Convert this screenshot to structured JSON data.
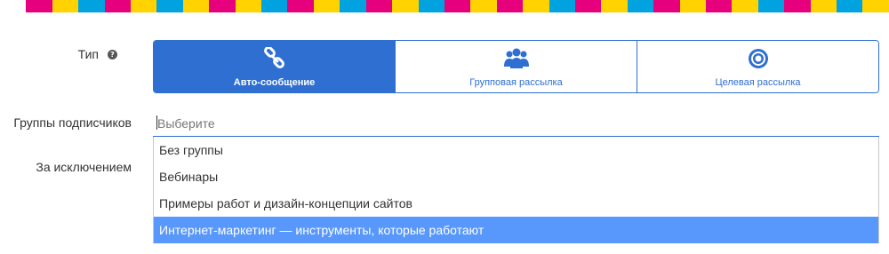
{
  "stripe_colors": [
    "#ffffff",
    "#e6007e",
    "#ffd200",
    "#00a3e0",
    "#e6007e",
    "#ffd200",
    "#00a3e0",
    "#ffd200",
    "#e6007e",
    "#ffd200",
    "#00a3e0",
    "#e6007e",
    "#ffd200",
    "#00a3e0",
    "#e6007e",
    "#ffd200",
    "#00a3e0",
    "#e6007e",
    "#ffd200",
    "#e6007e",
    "#ffd200",
    "#00a3e0",
    "#e6007e",
    "#ffd200",
    "#00a3e0",
    "#e6007e",
    "#ffd200",
    "#e6007e",
    "#ffd200",
    "#00a3e0",
    "#e6007e",
    "#ffd200",
    "#00a3e0",
    "#ffd200"
  ],
  "form": {
    "type_label": "Тип",
    "help_glyph": "?",
    "groups_label": "Группы подписчиков",
    "except_label": "За исключением"
  },
  "type_options": [
    {
      "label": "Авто-сообщение",
      "icon": "link-icon",
      "active": true
    },
    {
      "label": "Групповая рассылка",
      "icon": "users-icon",
      "active": false
    },
    {
      "label": "Целевая рассылка",
      "icon": "target-icon",
      "active": false
    }
  ],
  "search": {
    "placeholder": "Выберите"
  },
  "dropdown": {
    "options": [
      "Без группы",
      "Вебинары",
      "Примеры работ и дизайн-концепции сайтов",
      "Интернет-маркетинг — инструменты, которые работают"
    ],
    "highlighted_index": 3
  },
  "colors": {
    "accent": "#2e6fd1",
    "highlight": "#5897fb"
  }
}
